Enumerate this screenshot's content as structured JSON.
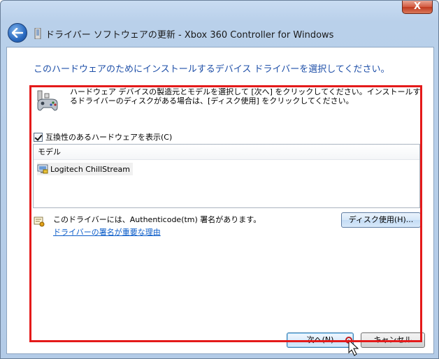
{
  "window": {
    "title": "ドライバー ソフトウェアの更新 - Xbox 360 Controller for Windows",
    "close_label": "X"
  },
  "heading": "このハードウェアのためにインストールするデバイス ドライバーを選択してください。",
  "description": "ハードウェア デバイスの製造元とモデルを選択して [次へ] をクリックしてください。インストールするドライバーのディスクがある場合は、[ディスク使用] をクリックしてください。",
  "compat_checkbox": {
    "label": "互換性のあるハードウェアを表示(C)",
    "checked": true
  },
  "model_list": {
    "header": "モデル",
    "items": [
      {
        "label": "Logitech ChillStream"
      }
    ]
  },
  "signature": {
    "text": "このドライバーには、Authenticode(tm) 署名があります。",
    "link": "ドライバーの署名が重要な理由"
  },
  "buttons": {
    "disk": "ディスク使用(H)...",
    "next": "次へ(N)",
    "cancel": "キャンセル"
  },
  "colors": {
    "heading": "#1e4fa8",
    "link": "#0b5cc9",
    "highlight_frame": "#e41a1a"
  },
  "icons": {
    "back": "back-arrow-icon",
    "app": "device-icon",
    "hardware": "game-controller-icon",
    "model_item": "device-driver-icon",
    "signature": "certificate-icon",
    "cursor": "mouse-pointer-icon"
  }
}
